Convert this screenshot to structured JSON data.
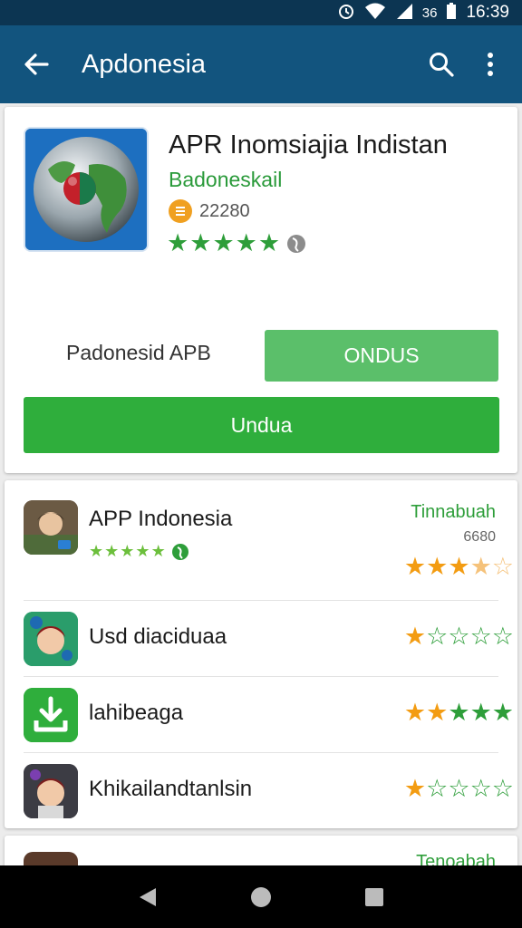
{
  "status_bar": {
    "time": "16:39",
    "network_label": "36"
  },
  "app_bar": {
    "title": "Apdonesia"
  },
  "hero": {
    "title": "APR Inomsiajia Indistan",
    "developer": "Badoneskail",
    "count": "22280",
    "rating_stars": 4.5,
    "secondary_label": "Padonesid APB",
    "secondary_button": "ONDUS",
    "primary_button": "Undua"
  },
  "list": {
    "items": [
      {
        "title": "APP Indonesia",
        "action": "Tinnabuah",
        "count": "6680",
        "rating": 3.5
      },
      {
        "title": "Usd diaciduaa",
        "rating": 1.5
      },
      {
        "title": "lahibeaga",
        "rating": 4
      },
      {
        "title": "Khikailandtanlsin",
        "rating": 1
      }
    ],
    "peek_action": "Tenoabah"
  },
  "colors": {
    "app_bar": "#12547e",
    "status_bar": "#0c3552",
    "primary_green": "#2fae3c",
    "light_green": "#5bbf6a",
    "star_orange": "#f39c12",
    "star_green": "#2e9e3a"
  }
}
